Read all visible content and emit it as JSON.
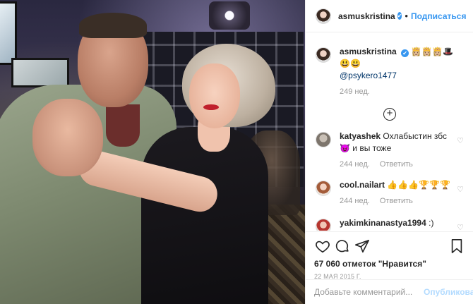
{
  "post": {
    "author": "asmuskristina",
    "follow_label": "Подписаться",
    "separator": "•",
    "verified_glyph": "✔"
  },
  "caption": {
    "username": "asmuskristina",
    "text": "👸🏼👸🏼👸🏼🎩😃😃",
    "mention": "@psykero1477",
    "time": "249 нед."
  },
  "load_more_icon": "plus-circle-icon",
  "comments": [
    {
      "username": "katyashek",
      "text": "Охлабыстин збс😈 и вы тоже",
      "time": "244 нед.",
      "reply": "Ответить"
    },
    {
      "username": "cool.nailart",
      "text": "👍👍👍🏆🏆🏆",
      "time": "244 нед.",
      "reply": "Ответить"
    },
    {
      "username": "yakimkinanastya1994",
      "text": ":) прекрасны"
    }
  ],
  "likes_text": "67 060 отметок \"Нравится\"",
  "date": "22 МАЯ 2015 Г.",
  "comment_input": {
    "placeholder": "Добавьте комментарий...",
    "publish": "Опубликовать"
  },
  "colors": {
    "link": "#3897f0",
    "muted": "#999999",
    "publish_disabled": "#b3dbff"
  }
}
